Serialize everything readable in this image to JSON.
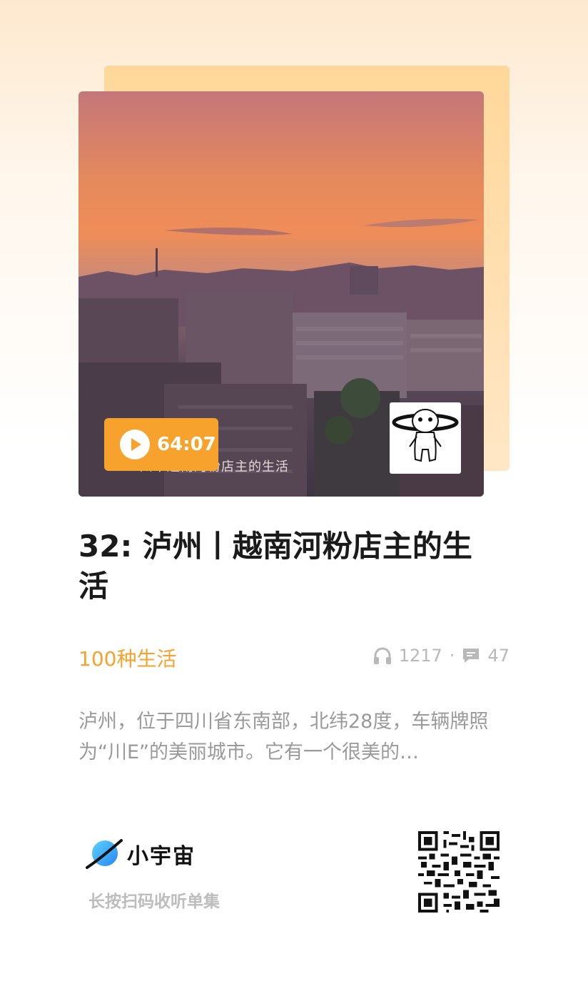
{
  "episode": {
    "duration": "64:07",
    "title": "32: 泸州丨越南河粉店主的生活",
    "cover_caption": "州丨越南河粉店主的生活",
    "podcast_name": "100种生活",
    "play_count": "1217",
    "comment_count": "47",
    "stats_separator": "·",
    "description": "泸州，位于四川省东南部，北纬28度，车辆牌照为“川E”的美丽城市。它有一个很美的…"
  },
  "brand": {
    "name": "小宇宙",
    "hint": "长按扫码收听单集"
  },
  "colors": {
    "accent": "#f7a22d",
    "title": "#1a1a1a",
    "muted": "#9a9a9a"
  },
  "icons": [
    "play-icon",
    "headphones-icon",
    "comment-icon",
    "planet-logo-icon",
    "qr-code"
  ]
}
